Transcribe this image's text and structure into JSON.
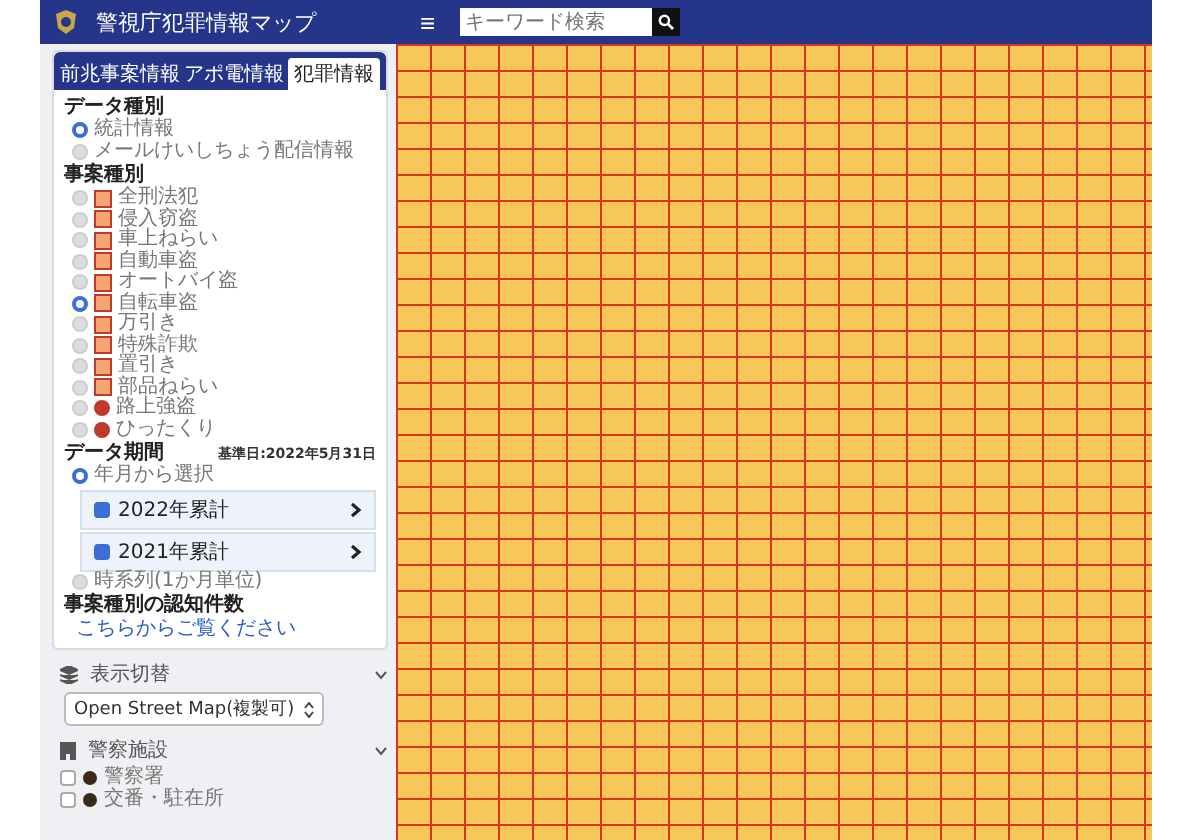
{
  "header": {
    "title": "警視庁犯罪情報マップ",
    "menu_icon": "≡",
    "search": {
      "placeholder": "キーワード検索"
    }
  },
  "tabs": [
    {
      "label": "前兆事案情報",
      "selected": false
    },
    {
      "label": "アポ電情報",
      "selected": false
    },
    {
      "label": "犯罪情報",
      "selected": true
    }
  ],
  "data_type": {
    "title": "データ種別",
    "options": [
      {
        "label": "統計情報",
        "selected": true
      },
      {
        "label": "メールけいしちょう配信情報",
        "selected": false
      }
    ]
  },
  "incident_type": {
    "title": "事案種別",
    "options": [
      {
        "label": "全刑法犯",
        "selected": false,
        "kind": "area"
      },
      {
        "label": "侵入窃盗",
        "selected": false,
        "kind": "area"
      },
      {
        "label": "車上ねらい",
        "selected": false,
        "kind": "area"
      },
      {
        "label": "自動車盗",
        "selected": false,
        "kind": "area"
      },
      {
        "label": "オートバイ盗",
        "selected": false,
        "kind": "area"
      },
      {
        "label": "自転車盗",
        "selected": true,
        "kind": "area"
      },
      {
        "label": "万引き",
        "selected": false,
        "kind": "area"
      },
      {
        "label": "特殊詐欺",
        "selected": false,
        "kind": "area"
      },
      {
        "label": "置引き",
        "selected": false,
        "kind": "area"
      },
      {
        "label": "部品ねらい",
        "selected": false,
        "kind": "area"
      },
      {
        "label": "路上強盗",
        "selected": false,
        "kind": "point"
      },
      {
        "label": "ひったくり",
        "selected": false,
        "kind": "point"
      }
    ]
  },
  "period": {
    "title": "データ期間",
    "base_date": "基準日:2022年5月31日",
    "modes": [
      {
        "label": "年月から選択",
        "selected": true,
        "entries": [
          {
            "label": "2022年累計",
            "checked": true
          },
          {
            "label": "2021年累計",
            "checked": true
          }
        ]
      },
      {
        "label": "時系列(1か月単位)",
        "selected": false
      }
    ]
  },
  "counts": {
    "title": "事案種別の認知件数",
    "link": "こちらからご覧ください"
  },
  "display": {
    "title": "表示切替",
    "select_value": "Open Street Map(複製可)"
  },
  "facilities": {
    "title": "警察施設",
    "items": [
      {
        "label": "警察署",
        "checked": false
      },
      {
        "label": "交番・駐在所",
        "checked": false
      }
    ]
  }
}
